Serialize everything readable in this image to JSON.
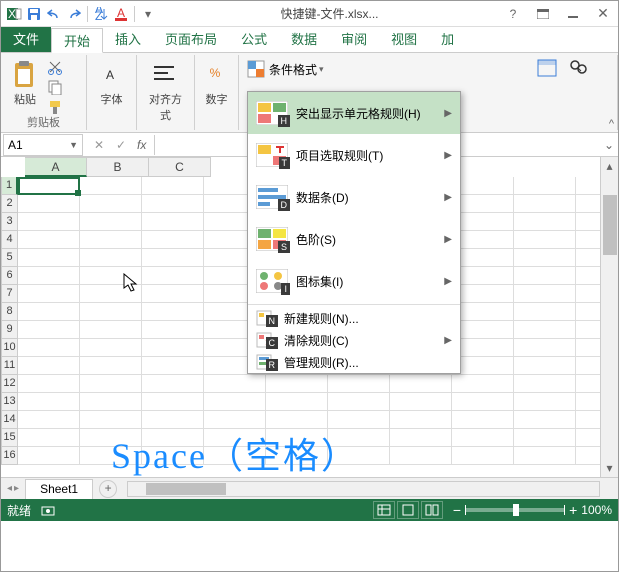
{
  "titlebar": {
    "title": "快捷键-文件.xlsx..."
  },
  "tabs": {
    "file": "文件",
    "home": "开始",
    "insert": "插入",
    "layout": "页面布局",
    "formulas": "公式",
    "data": "数据",
    "review": "审阅",
    "view": "视图",
    "addin": "加"
  },
  "ribbon": {
    "paste": "粘贴",
    "clipboard": "剪贴板",
    "font": "字体",
    "align": "对齐方式",
    "number": "数字",
    "cond_format": "条件格式"
  },
  "dropdown": {
    "highlight": "突出显示单元格规则(H)",
    "top": "项目选取规则(T)",
    "databar": "数据条(D)",
    "colorscale": "色阶(S)",
    "iconset": "图标集(I)",
    "new": "新建规则(N)...",
    "clear": "清除规则(C)",
    "manage": "管理规则(R)...",
    "keys": {
      "h": "H",
      "t": "T",
      "d": "D",
      "s": "S",
      "i": "I",
      "n": "N",
      "c": "C",
      "r": "R"
    }
  },
  "namebox": {
    "value": "A1"
  },
  "columns": [
    "A",
    "B",
    "C"
  ],
  "rows": [
    "1",
    "2",
    "3",
    "4",
    "5",
    "6",
    "7",
    "8",
    "9",
    "10",
    "11",
    "12",
    "13",
    "14",
    "15",
    "16"
  ],
  "sheets": {
    "sheet1": "Sheet1"
  },
  "statusbar": {
    "ready": "就绪",
    "zoom": "100%"
  },
  "overlay": "Space（空格）"
}
